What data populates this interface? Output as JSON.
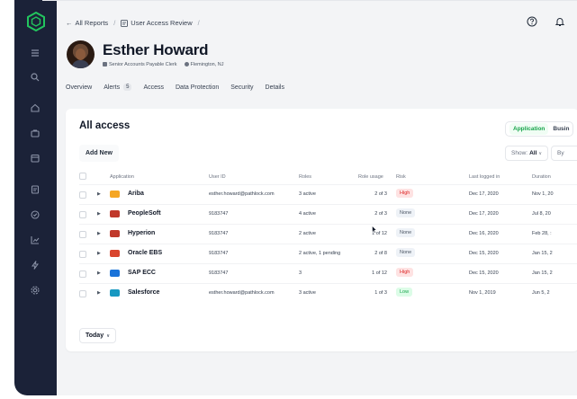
{
  "breadcrumbs": {
    "back_label": "All Reports",
    "current_label": "User Access Review"
  },
  "user": {
    "name": "Esther Howard",
    "role": "Senior Accounts Payable Clerk",
    "location": "Flemington, NJ"
  },
  "tabs": [
    {
      "label": "Overview"
    },
    {
      "label": "Alerts",
      "badge": "5"
    },
    {
      "label": "Access"
    },
    {
      "label": "Data Protection"
    },
    {
      "label": "Security"
    },
    {
      "label": "Details"
    }
  ],
  "card": {
    "title": "All access",
    "segment": {
      "active": "Application",
      "inactive": "Busin"
    },
    "add_new": "Add New",
    "show_label": "Show:",
    "show_value": "All",
    "by_label": "By",
    "today_label": "Today"
  },
  "table": {
    "headers": {
      "application": "Application",
      "user_id": "User ID",
      "roles": "Roles",
      "role_usage": "Role usage",
      "risk": "Risk",
      "last_logged_in": "Last logged in",
      "duration": "Duration"
    },
    "rows": [
      {
        "app": "Ariba",
        "logo_color": "#f5a623",
        "user_id": "esther.howard@pathlock.com",
        "roles": "3 active",
        "usage": "2 of 3",
        "risk": "High",
        "risk_level": "high",
        "last": "Dec 17, 2020",
        "duration": "Nov 1, 20"
      },
      {
        "app": "PeopleSoft",
        "logo_color": "#c0392b",
        "user_id": "9183747",
        "roles": "4 active",
        "usage": "2 of 3",
        "risk": "None",
        "risk_level": "none",
        "last": "Dec 17, 2020",
        "duration": "Jul 8, 20"
      },
      {
        "app": "Hyperion",
        "logo_color": "#c0392b",
        "user_id": "9183747",
        "roles": "2 active",
        "usage": "1 of 12",
        "risk": "None",
        "risk_level": "none",
        "last": "Dec 16, 2020",
        "duration": "Feb 28, :"
      },
      {
        "app": "Oracle EBS",
        "logo_color": "#d9452e",
        "user_id": "9183747",
        "roles": "2 active, 1 pending",
        "usage": "2 of 8",
        "risk": "None",
        "risk_level": "none",
        "last": "Dec 15, 2020",
        "duration": "Jan 15, 2"
      },
      {
        "app": "SAP ECC",
        "logo_color": "#1a73d9",
        "user_id": "9183747",
        "roles": "3",
        "usage": "1 of 12",
        "risk": "High",
        "risk_level": "high",
        "last": "Dec 15, 2020",
        "duration": "Jan 15, 2"
      },
      {
        "app": "Salesforce",
        "logo_color": "#1798c1",
        "user_id": "esther.howard@pathlock.com",
        "roles": "3 active",
        "usage": "1 of 3",
        "risk": "Low",
        "risk_level": "low",
        "last": "Nov 1, 2019",
        "duration": "Jun 5, 2"
      }
    ]
  },
  "colors": {
    "sidebar": "#1b2238",
    "accent": "#22c55e",
    "high": "#dc2626",
    "low": "#16a34a"
  },
  "icons": [
    "logo-icon",
    "list-icon",
    "search-icon",
    "home-icon",
    "briefcase-icon",
    "calendar-icon",
    "document-icon",
    "check-circle-icon",
    "chart-icon",
    "bolt-icon",
    "settings-icon",
    "help-icon",
    "bell-icon"
  ]
}
